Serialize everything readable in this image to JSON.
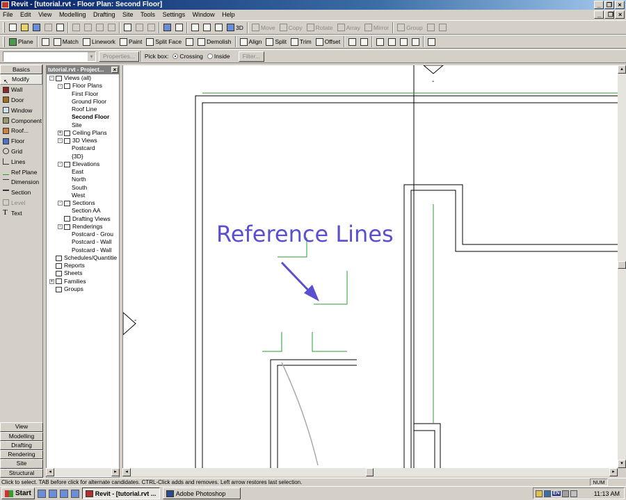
{
  "window": {
    "title": "Revit - [tutorial.rvt - Floor Plan: Second Floor]"
  },
  "menu": [
    "File",
    "Edit",
    "View",
    "Modelling",
    "Drafting",
    "Site",
    "Tools",
    "Settings",
    "Window",
    "Help"
  ],
  "toolbar1": {
    "view3d_label": "3D",
    "move": "Move",
    "copy": "Copy",
    "rotate": "Rotate",
    "array": "Array",
    "mirror": "Mirror",
    "group": "Group"
  },
  "toolbar2": {
    "plane": "Plane",
    "match": "Match",
    "linework": "Linework",
    "paint": "Paint",
    "split_face": "Split Face",
    "demolish": "Demolish",
    "align": "Align",
    "split": "Split",
    "trim": "Trim",
    "offset": "Offset"
  },
  "options_bar": {
    "properties": "Properties...",
    "pick_box": "Pick box:",
    "crossing": "Crossing",
    "inside": "Inside",
    "filter": "Filter..."
  },
  "design_bar": {
    "tab": "Basics",
    "items": [
      {
        "label": "Modify",
        "icon": "cursor-icon"
      },
      {
        "label": "Wall",
        "icon": "wall-icon"
      },
      {
        "label": "Door",
        "icon": "door-icon"
      },
      {
        "label": "Window",
        "icon": "window-icon"
      },
      {
        "label": "Component",
        "icon": "component-icon"
      },
      {
        "label": "Roof...",
        "icon": "roof-icon"
      },
      {
        "label": "Floor",
        "icon": "floor-icon"
      },
      {
        "label": "Grid",
        "icon": "grid-icon"
      },
      {
        "label": "Lines",
        "icon": "lines-icon"
      },
      {
        "label": "Ref Plane",
        "icon": "ref-plane-icon"
      },
      {
        "label": "Dimension",
        "icon": "dimension-icon"
      },
      {
        "label": "Section",
        "icon": "section-icon"
      },
      {
        "label": "Level",
        "icon": "level-icon"
      },
      {
        "label": "Text",
        "icon": "text-icon"
      }
    ],
    "bottom_tabs": [
      "View",
      "Modelling",
      "Drafting",
      "Rendering",
      "Site",
      "Structural"
    ]
  },
  "project_browser": {
    "title": "tutorial.rvt - Project...",
    "tree": [
      {
        "label": "Views (all)",
        "level": 0,
        "toggle": "-",
        "icon": true
      },
      {
        "label": "Floor Plans",
        "level": 1,
        "toggle": "-",
        "icon": true
      },
      {
        "label": "First Floor",
        "level": 2
      },
      {
        "label": "Ground Floor",
        "level": 2
      },
      {
        "label": "Roof Line",
        "level": 2
      },
      {
        "label": "Second Floor",
        "level": 2,
        "bold": true
      },
      {
        "label": "Site",
        "level": 2
      },
      {
        "label": "Ceiling Plans",
        "level": 1,
        "toggle": "+",
        "icon": true
      },
      {
        "label": "3D Views",
        "level": 1,
        "toggle": "-",
        "icon": true
      },
      {
        "label": "Postcard",
        "level": 2
      },
      {
        "label": "{3D}",
        "level": 2
      },
      {
        "label": "Elevations",
        "level": 1,
        "toggle": "-",
        "icon": true
      },
      {
        "label": "East",
        "level": 2
      },
      {
        "label": "North",
        "level": 2
      },
      {
        "label": "South",
        "level": 2
      },
      {
        "label": "West",
        "level": 2
      },
      {
        "label": "Sections",
        "level": 1,
        "toggle": "-",
        "icon": true
      },
      {
        "label": "Section AA",
        "level": 2
      },
      {
        "label": "Drafting Views",
        "level": 1,
        "icon": true
      },
      {
        "label": "Renderings",
        "level": 1,
        "toggle": "-",
        "icon": true
      },
      {
        "label": "Postcard - Grou",
        "level": 2
      },
      {
        "label": "Postcard - Wall",
        "level": 2
      },
      {
        "label": "Postcard - Wall",
        "level": 2
      },
      {
        "label": "Schedules/Quantitie",
        "level": 0,
        "icon": true
      },
      {
        "label": "Reports",
        "level": 0,
        "icon": true
      },
      {
        "label": "Sheets",
        "level": 0,
        "icon": true
      },
      {
        "label": "Families",
        "level": 0,
        "toggle": "+",
        "icon": true
      },
      {
        "label": "Groups",
        "level": 0,
        "icon": true
      }
    ]
  },
  "canvas": {
    "annotation": "Reference Lines",
    "annotation_color": "#5a4fd0",
    "ref_line_color": "#2e9a2e"
  },
  "status": {
    "message": "Click to select. TAB before click for alternate candidates. CTRL-Click adds and removes. Left arrow restores last selection.",
    "num": "NUM"
  },
  "taskbar": {
    "start": "Start",
    "tasks": [
      "Revit - [tutorial.rvt ...",
      "Adobe Photoshop"
    ],
    "lang": "EN",
    "clock": "11:13 AM"
  }
}
